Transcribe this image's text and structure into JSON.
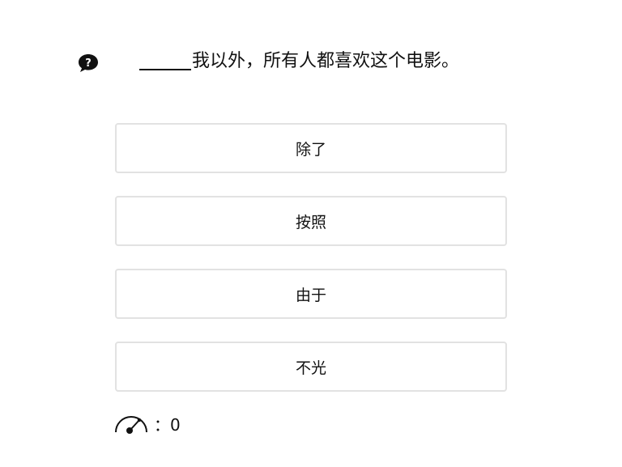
{
  "question": {
    "icon": "question-speech-bubble-icon",
    "text": "我以外，所有人都喜欢这个电影。"
  },
  "options": [
    {
      "label": "除了"
    },
    {
      "label": "按照"
    },
    {
      "label": "由于"
    },
    {
      "label": "不光"
    }
  ],
  "score": {
    "icon": "speedometer-icon",
    "label": "：0"
  }
}
